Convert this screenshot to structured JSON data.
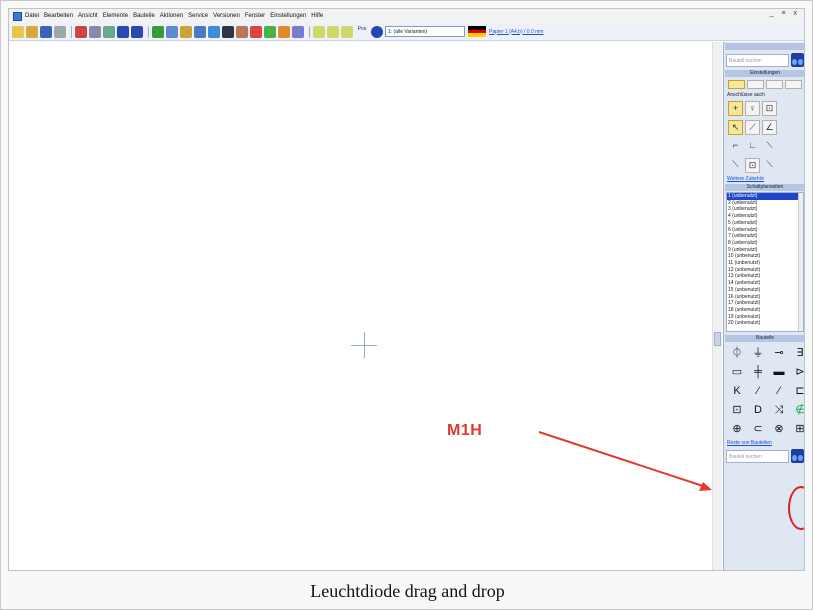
{
  "menu": {
    "items": [
      "Datei",
      "Bearbeiten",
      "Ansicht",
      "Elemente",
      "Bauteile",
      "Aktionen",
      "Service",
      "Versionen",
      "Fenster",
      "Einstellungen",
      "Hilfe"
    ],
    "window_controls": "_ ≡ x"
  },
  "toolbar": {
    "variant_value": "1: (alle Varianten)",
    "page_link": "Papier 1 (A4,b) / 0.0 mm",
    "pos_label": "Pos"
  },
  "canvas": {
    "annotation": "M1H",
    "annotation_color": "#e23a2c"
  },
  "panel": {
    "search_placeholder": "Bauteil suchen",
    "settings_title": "Einstellungen",
    "anschluesse_label": "Anschlüsse auch",
    "weitere_link": "Weitere Zubehör",
    "schaltplan_title": "Schaltplanseiten",
    "pages": [
      "1 (unbenutzt)",
      "2 (unbenutzt)",
      "3 (unbenutzt)",
      "4 (unbenutzt)",
      "5 (unbenutzt)",
      "6 (unbenutzt)",
      "7 (unbenutzt)",
      "8 (unbenutzt)",
      "9 (unbenutzt)",
      "10 (unbenutzt)",
      "11 (unbenutzt)",
      "12 (unbenutzt)",
      "13 (unbenutzt)",
      "14 (unbenutzt)",
      "15 (unbenutzt)",
      "16 (unbenutzt)",
      "17 (unbenutzt)",
      "18 (unbenutzt)",
      "19 (unbenutzt)",
      "20 (unbenutzt)"
    ],
    "bauteile_title": "Bauteile",
    "parts": [
      "⏀",
      "⏚",
      "⊸",
      "∃",
      "▭",
      "╪",
      "▬",
      "⊳",
      "K",
      "⁄",
      "⁄",
      "⊏",
      "⊡",
      "D",
      "⤨",
      "∉",
      "⊕",
      "⊂",
      "⊗",
      "⊞"
    ],
    "parts_link": "Reste von Bauteilen",
    "bottom_search_placeholder": "Bauteil suchen"
  },
  "caption": "Leuchtdiode drag and drop"
}
